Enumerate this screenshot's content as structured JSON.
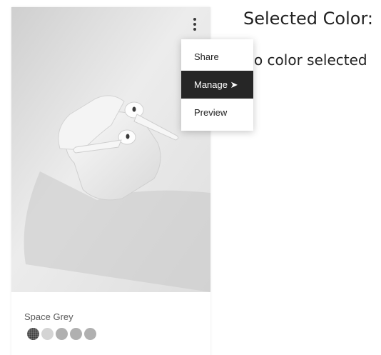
{
  "product": {
    "color_name": "Space Grey",
    "swatches": [
      {
        "color": "#6d6d6d",
        "selected": true
      },
      {
        "color": "#d4d4d4",
        "selected": false
      },
      {
        "color": "#b0b0b0",
        "selected": false
      },
      {
        "color": "#b0b0b0",
        "selected": false
      },
      {
        "color": "#b0b0b0",
        "selected": false
      }
    ]
  },
  "menu": {
    "items": [
      {
        "label": "Share"
      },
      {
        "label": "Manage ➤"
      },
      {
        "label": "Preview"
      }
    ],
    "active_index": 1
  },
  "selection": {
    "title": "Selected Color:",
    "value": "No color selected"
  },
  "icons": {
    "more": "vertical-ellipsis-icon"
  }
}
